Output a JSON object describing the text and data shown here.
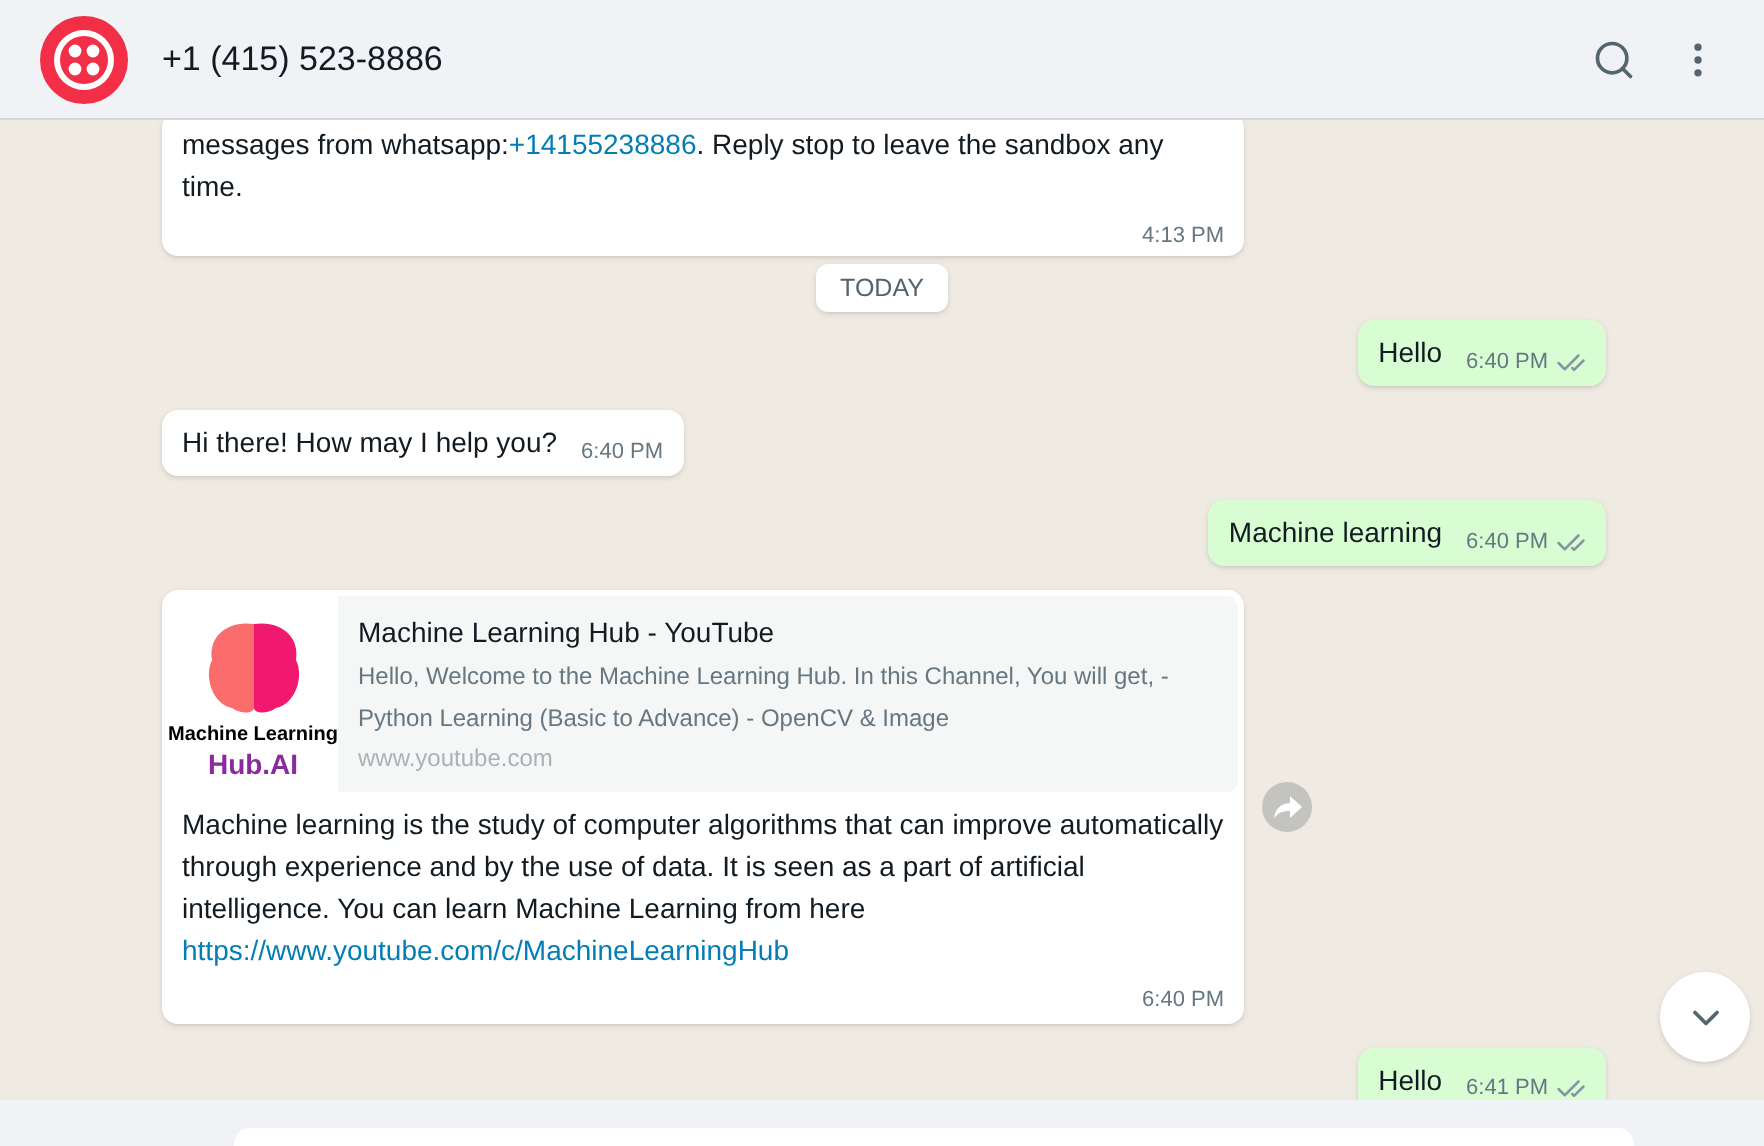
{
  "header": {
    "title": "+1 (415) 523-8886"
  },
  "date_chip": "TODAY",
  "messages": [
    {
      "kind": "incoming_cut",
      "text": "messages from whatsapp:",
      "link": "+14155238886",
      "text_after": ". Reply stop to leave the sandbox any time.",
      "time": "4:13 PM"
    },
    {
      "kind": "outgoing",
      "text": "Hello",
      "time": "6:40 PM",
      "read": false
    },
    {
      "kind": "incoming",
      "text": "Hi there! How may I help you?",
      "time": "6:40 PM"
    },
    {
      "kind": "outgoing",
      "text": "Machine learning",
      "time": "6:40 PM",
      "read": false
    },
    {
      "kind": "incoming_link",
      "preview": {
        "thumb_lines": [
          "Machine Learning",
          "Hub.AI"
        ],
        "title": "Machine Learning Hub - YouTube",
        "description": "Hello, Welcome to the Machine Learning Hub. In this Channel, You will get, - Python Learning (Basic to Advance) - OpenCV & Image",
        "domain": "www.youtube.com"
      },
      "text": "Machine learning is the study of computer algorithms that can improve automatically through experience and by the use of data. It is seen as a part of artificial intelligence. You can learn Machine Learning from here ",
      "link": "https://www.youtube.com/c/MachineLearningHub",
      "time": "6:40 PM"
    },
    {
      "kind": "outgoing",
      "text": "Hello",
      "time": "6:41 PM",
      "read": false
    },
    {
      "kind": "incoming_hidden"
    }
  ]
}
